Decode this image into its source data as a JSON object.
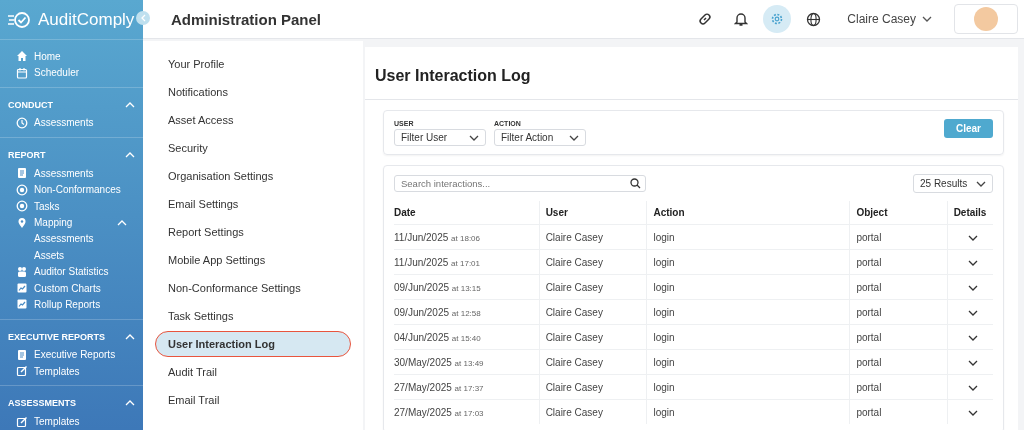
{
  "sidebar": {
    "brand": "AuditComply",
    "top_items": [
      {
        "label": "Home"
      },
      {
        "label": "Scheduler"
      }
    ],
    "sections": [
      {
        "title": "CONDUCT",
        "expanded": true,
        "items": [
          {
            "label": "Assessments"
          }
        ]
      },
      {
        "title": "REPORT",
        "expanded": true,
        "items": [
          {
            "label": "Assessments"
          },
          {
            "label": "Non-Conformances"
          },
          {
            "label": "Tasks"
          },
          {
            "label": "Mapping",
            "expanded": true,
            "children": [
              {
                "label": "Assessments"
              },
              {
                "label": "Assets"
              }
            ]
          },
          {
            "label": "Auditor Statistics"
          },
          {
            "label": "Custom Charts"
          },
          {
            "label": "Rollup Reports"
          }
        ]
      },
      {
        "title": "EXECUTIVE REPORTS",
        "expanded": true,
        "items": [
          {
            "label": "Executive Reports"
          },
          {
            "label": "Templates"
          }
        ]
      },
      {
        "title": "ASSESSMENTS",
        "expanded": true,
        "items": [
          {
            "label": "Templates"
          }
        ]
      }
    ]
  },
  "header": {
    "title": "Administration Panel",
    "user_name": "Claire Casey",
    "settings_selected": true
  },
  "settings_nav": [
    {
      "label": "Your Profile",
      "selected": false
    },
    {
      "label": "Notifications",
      "selected": false
    },
    {
      "label": "Asset Access",
      "selected": false
    },
    {
      "label": "Security",
      "selected": false
    },
    {
      "label": "Organisation Settings",
      "selected": false
    },
    {
      "label": "Email Settings",
      "selected": false
    },
    {
      "label": "Report Settings",
      "selected": false
    },
    {
      "label": "Mobile App Settings",
      "selected": false
    },
    {
      "label": "Non-Conformance Settings",
      "selected": false
    },
    {
      "label": "Task Settings",
      "selected": false
    },
    {
      "label": "User Interaction Log",
      "selected": true
    },
    {
      "label": "Audit Trail",
      "selected": false
    },
    {
      "label": "Email Trail",
      "selected": false
    }
  ],
  "panel": {
    "title": "User Interaction Log",
    "filters": [
      {
        "label": "USER",
        "value": "Filter User"
      },
      {
        "label": "ACTION",
        "value": "Filter Action"
      }
    ],
    "clear_button": "Clear",
    "search": {
      "placeholder": "Search interactions..."
    },
    "results": "25 Results",
    "table": {
      "columns": [
        "Date",
        "User",
        "Action",
        "Object",
        "Details"
      ],
      "rows": [
        {
          "date": "11/Jun/2025",
          "time": "at 18:06",
          "user": "Claire Casey",
          "action": "login",
          "object": "portal"
        },
        {
          "date": "11/Jun/2025",
          "time": "at 17:01",
          "user": "Claire Casey",
          "action": "login",
          "object": "portal"
        },
        {
          "date": "09/Jun/2025",
          "time": "at 13:15",
          "user": "Claire Casey",
          "action": "login",
          "object": "portal"
        },
        {
          "date": "09/Jun/2025",
          "time": "at 12:58",
          "user": "Claire Casey",
          "action": "login",
          "object": "portal"
        },
        {
          "date": "04/Jun/2025",
          "time": "at 15:40",
          "user": "Claire Casey",
          "action": "login",
          "object": "portal"
        },
        {
          "date": "30/May/2025",
          "time": "at 13:49",
          "user": "Claire Casey",
          "action": "login",
          "object": "portal"
        },
        {
          "date": "27/May/2025",
          "time": "at 17:37",
          "user": "Claire Casey",
          "action": "login",
          "object": "portal"
        },
        {
          "date": "27/May/2025",
          "time": "at 17:03",
          "user": "Claire Casey",
          "action": "login",
          "object": "portal"
        }
      ]
    }
  }
}
